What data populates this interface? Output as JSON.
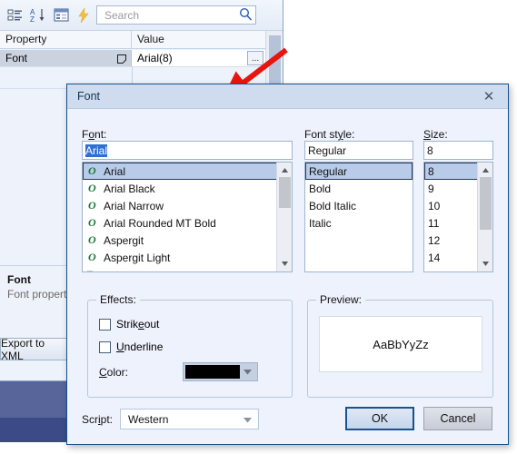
{
  "background": {
    "toolbar": {
      "icons": [
        "categorized-view-icon",
        "alphabetical-sort-icon",
        "property-pages-icon",
        "events-icon"
      ],
      "search": {
        "placeholder": "Search",
        "value": "",
        "icon": "search-icon"
      }
    },
    "property_grid": {
      "columns": [
        "Property",
        "Value"
      ],
      "rows": [
        {
          "property": "Font",
          "value": "Arial(8)",
          "editor_button": "...",
          "expand_glyph": "collapsed-box-icon"
        }
      ]
    },
    "description": {
      "title": "Font",
      "text": "Font property"
    },
    "export_button": "Export to XML"
  },
  "annotation": {
    "arrow": "red-arrow-pointer"
  },
  "dialog": {
    "title": "Font",
    "close_label": "✕",
    "labels": {
      "font": {
        "pre": "F",
        "mnemonic": "o",
        "post": "nt:"
      },
      "font_style": {
        "pre": "Font st",
        "mnemonic": "y",
        "post": "le:"
      },
      "size": {
        "pre": "",
        "mnemonic": "S",
        "post": "ize:"
      },
      "effects": "Effects:",
      "preview": "Preview:",
      "script": {
        "pre": "Scr",
        "mnemonic": "i",
        "post": "pt:"
      },
      "color": {
        "pre": "",
        "mnemonic": "C",
        "post": "olor:"
      },
      "strikeout": {
        "pre": "Strik",
        "mnemonic": "e",
        "post": "out"
      },
      "underline": {
        "pre": "",
        "mnemonic": "U",
        "post": "nderline"
      }
    },
    "font_field": {
      "value": "Arial",
      "selected": true
    },
    "font_list": {
      "items": [
        {
          "name": "Arial",
          "icon": "opentype-font-icon",
          "selected": true
        },
        {
          "name": "Arial Black",
          "icon": "opentype-font-icon",
          "selected": false
        },
        {
          "name": "Arial Narrow",
          "icon": "opentype-font-icon",
          "selected": false
        },
        {
          "name": "Arial Rounded MT Bold",
          "icon": "opentype-font-icon",
          "selected": false
        },
        {
          "name": "Aspergit",
          "icon": "opentype-font-icon",
          "selected": false
        },
        {
          "name": "Aspergit Light",
          "icon": "opentype-font-icon",
          "selected": false
        }
      ],
      "scrollbar": "vertical-scrollbar"
    },
    "style_field": {
      "value": "Regular"
    },
    "style_list": {
      "items": [
        {
          "name": "Regular",
          "selected": true
        },
        {
          "name": "Bold",
          "selected": false
        },
        {
          "name": "Bold Italic",
          "selected": false
        },
        {
          "name": "Italic",
          "selected": false
        }
      ]
    },
    "size_field": {
      "value": "8"
    },
    "size_list": {
      "items": [
        {
          "name": "8",
          "selected": true
        },
        {
          "name": "9",
          "selected": false
        },
        {
          "name": "10",
          "selected": false
        },
        {
          "name": "11",
          "selected": false
        },
        {
          "name": "12",
          "selected": false
        },
        {
          "name": "14",
          "selected": false
        }
      ],
      "scrollbar": "vertical-scrollbar"
    },
    "effects": {
      "strikeout_checked": false,
      "underline_checked": false,
      "color_value": "#000000"
    },
    "preview": {
      "sample_text": "AaBbYyZz"
    },
    "script": {
      "value": "Western"
    },
    "buttons": {
      "ok": "OK",
      "cancel": "Cancel"
    }
  },
  "colors": {
    "dialog_border": "#14508c",
    "title_bar": "#cfdcf0",
    "dialog_face": "#eef2fd",
    "selection_blue": "#b8ccea",
    "text_selection": "#2f6fd0",
    "arrow_red": "#e8150f",
    "band_mid_blue": "#57659a",
    "band_dark_blue": "#3c4b88"
  }
}
